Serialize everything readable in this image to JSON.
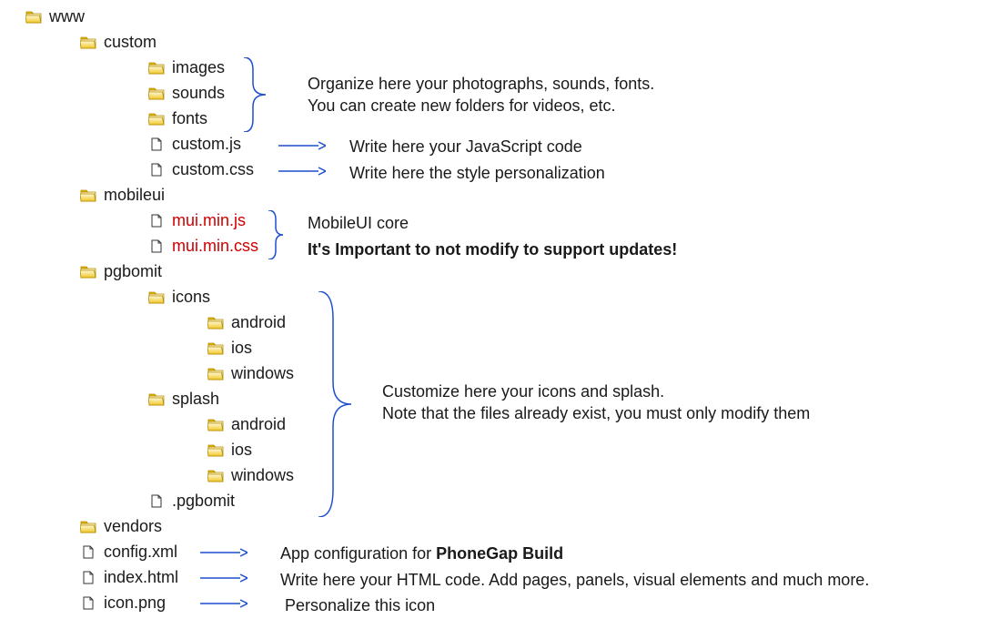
{
  "tree": {
    "root": "www",
    "custom": {
      "name": "custom",
      "children": {
        "images": "images",
        "sounds": "sounds",
        "fonts": "fonts",
        "custom_js": "custom.js",
        "custom_css": "custom.css"
      }
    },
    "mobileui": {
      "name": "mobileui",
      "children": {
        "mui_js": "mui.min.js",
        "mui_css": "mui.min.css"
      }
    },
    "pgbomit": {
      "name": "pgbomit",
      "icons": {
        "name": "icons",
        "android": "android",
        "ios": "ios",
        "windows": "windows"
      },
      "splash": {
        "name": "splash",
        "android": "android",
        "ios": "ios",
        "windows": "windows"
      },
      "dotfile": ".pgbomit"
    },
    "vendors": "vendors",
    "config_xml": "config.xml",
    "index_html": "index.html",
    "icon_png": "icon.png"
  },
  "notes": {
    "organize_line1": "Organize here your photographs, sounds, fonts.",
    "organize_line2": "You can create new folders for videos, etc.",
    "custom_js": "Write here your JavaScript code",
    "custom_css": "Write here the style personalization",
    "mui_core": "MobileUI core",
    "mui_warn": "It's Important to not modify to support updates!",
    "customize_line1": "Customize here your icons and splash.",
    "customize_line2": "Note that the files already exist, you must only modify them",
    "config_pre": "App configuration for ",
    "config_bold": "PhoneGap Build",
    "index_html": "Write here your HTML code. Add pages, panels, visual elements and much more.",
    "icon_png": "Personalize this icon"
  }
}
